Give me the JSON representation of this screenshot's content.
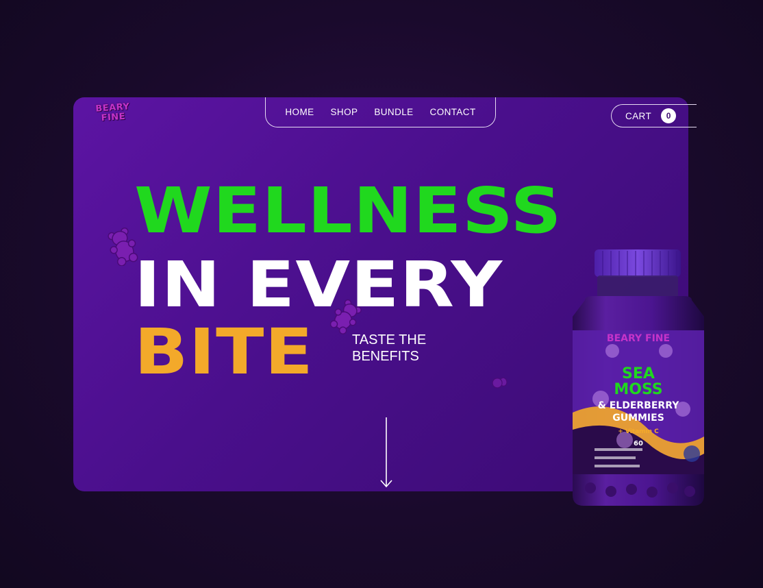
{
  "brand": {
    "logo_line1": "BEARY",
    "logo_line2": "FINE"
  },
  "nav": {
    "items": [
      "HOME",
      "SHOP",
      "BUNDLE",
      "CONTACT"
    ]
  },
  "cart": {
    "label": "CART",
    "count": "0"
  },
  "hero": {
    "line1": "WELLNESS",
    "line2": "IN EVERY",
    "line3": "BITE",
    "tagline_line1": "TASTE THE",
    "tagline_line2": "BENEFITS"
  },
  "product": {
    "brand": "BEARY FINE",
    "name_line1": "SEA",
    "name_line2": "MOSS",
    "name_line3": "& ELDERBERRY",
    "name_line4": "GUMMIES",
    "subtitle": "+ Vitamin C",
    "count": "60"
  },
  "colors": {
    "accent_green": "#20d81e",
    "accent_orange": "#f3a92a",
    "panel_purple": "#4a0f8c"
  }
}
